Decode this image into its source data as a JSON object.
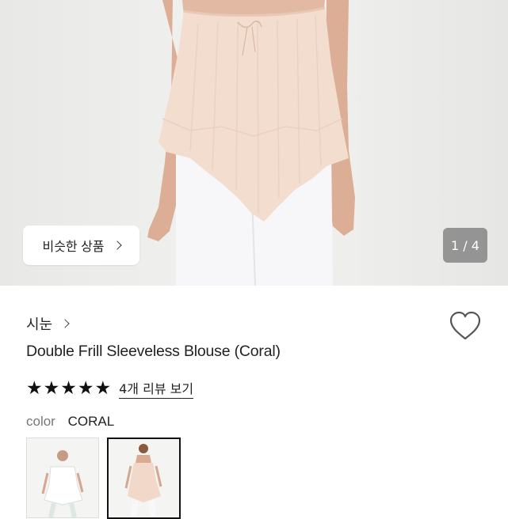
{
  "gallery": {
    "similar_button_label": "비슷한 상품",
    "counter": "1 / 4",
    "current_index": 1,
    "total": 4
  },
  "product": {
    "brand": "시눈",
    "title": "Double Frill Sleeveless Blouse (Coral)",
    "rating_stars": 5,
    "review_link": "4개 리뷰 보기"
  },
  "color": {
    "label": "color",
    "value": "CORAL",
    "options": [
      "white",
      "coral"
    ],
    "selected": "coral"
  },
  "colors": {
    "blouse": "#f3ddd0",
    "pants": "#f6f6f8",
    "skin": "#d9a98f",
    "counter_bg": "#7a7a7a"
  }
}
